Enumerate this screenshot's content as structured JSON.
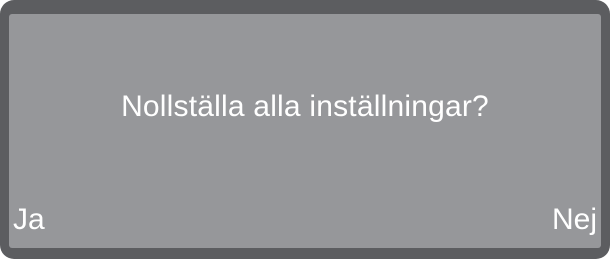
{
  "dialog": {
    "message": "Nollställa alla inställningar?",
    "yes_label": "Ja",
    "no_label": "Nej"
  },
  "colors": {
    "frame": "#5c5d60",
    "screen": "#96979a",
    "text": "#ffffff"
  }
}
